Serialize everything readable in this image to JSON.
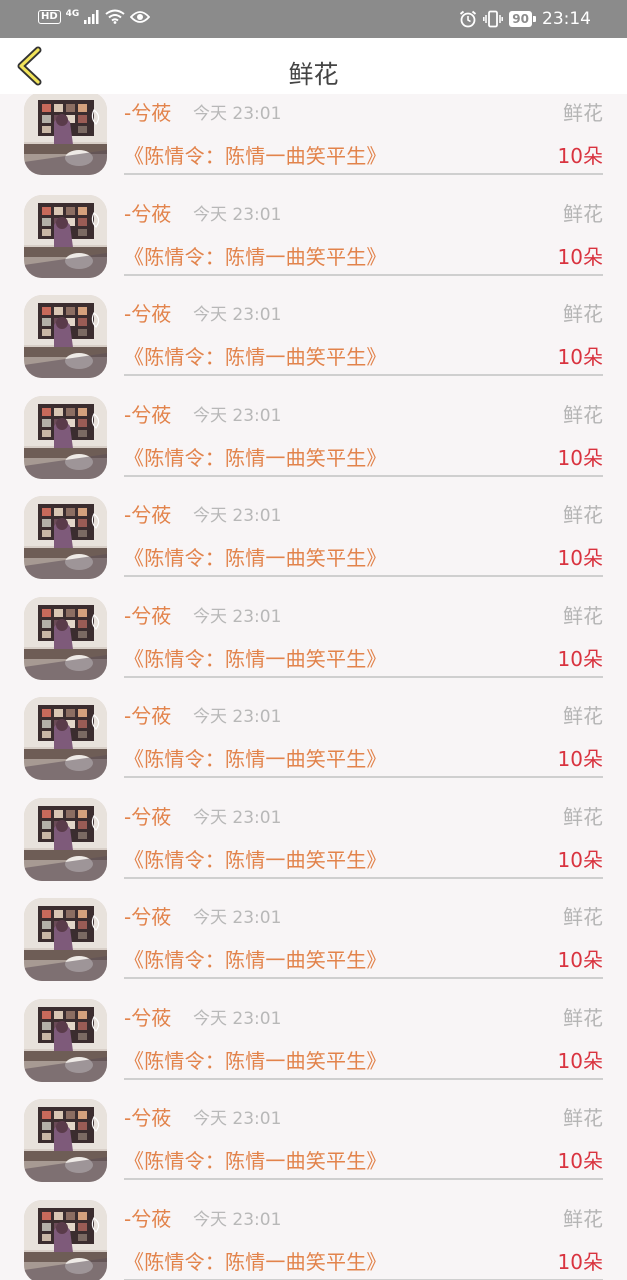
{
  "status_bar": {
    "hd": "HD",
    "network": "4G",
    "battery": "90",
    "time": "23:14"
  },
  "header": {
    "title": "鲜花",
    "back_icon": "chevron-left-icon"
  },
  "colors": {
    "accent": "#e2834b",
    "count": "#d9333f",
    "muted": "#b5b5b5",
    "background": "#f8f5f6"
  },
  "records": [
    {
      "user": "-兮莜",
      "time": "今天 23:01",
      "type": "鲜花",
      "work": "《陈情令：陈情一曲笑平生》",
      "count": "10朵"
    },
    {
      "user": "-兮莜",
      "time": "今天 23:01",
      "type": "鲜花",
      "work": "《陈情令：陈情一曲笑平生》",
      "count": "10朵"
    },
    {
      "user": "-兮莜",
      "time": "今天 23:01",
      "type": "鲜花",
      "work": "《陈情令：陈情一曲笑平生》",
      "count": "10朵"
    },
    {
      "user": "-兮莜",
      "time": "今天 23:01",
      "type": "鲜花",
      "work": "《陈情令：陈情一曲笑平生》",
      "count": "10朵"
    },
    {
      "user": "-兮莜",
      "time": "今天 23:01",
      "type": "鲜花",
      "work": "《陈情令：陈情一曲笑平生》",
      "count": "10朵"
    },
    {
      "user": "-兮莜",
      "time": "今天 23:01",
      "type": "鲜花",
      "work": "《陈情令：陈情一曲笑平生》",
      "count": "10朵"
    },
    {
      "user": "-兮莜",
      "time": "今天 23:01",
      "type": "鲜花",
      "work": "《陈情令：陈情一曲笑平生》",
      "count": "10朵"
    },
    {
      "user": "-兮莜",
      "time": "今天 23:01",
      "type": "鲜花",
      "work": "《陈情令：陈情一曲笑平生》",
      "count": "10朵"
    },
    {
      "user": "-兮莜",
      "time": "今天 23:01",
      "type": "鲜花",
      "work": "《陈情令：陈情一曲笑平生》",
      "count": "10朵"
    },
    {
      "user": "-兮莜",
      "time": "今天 23:01",
      "type": "鲜花",
      "work": "《陈情令：陈情一曲笑平生》",
      "count": "10朵"
    },
    {
      "user": "-兮莜",
      "time": "今天 23:01",
      "type": "鲜花",
      "work": "《陈情令：陈情一曲笑平生》",
      "count": "10朵"
    },
    {
      "user": "-兮莜",
      "time": "今天 23:01",
      "type": "鲜花",
      "work": "《陈情令：陈情一曲笑平生》",
      "count": "10朵"
    }
  ]
}
